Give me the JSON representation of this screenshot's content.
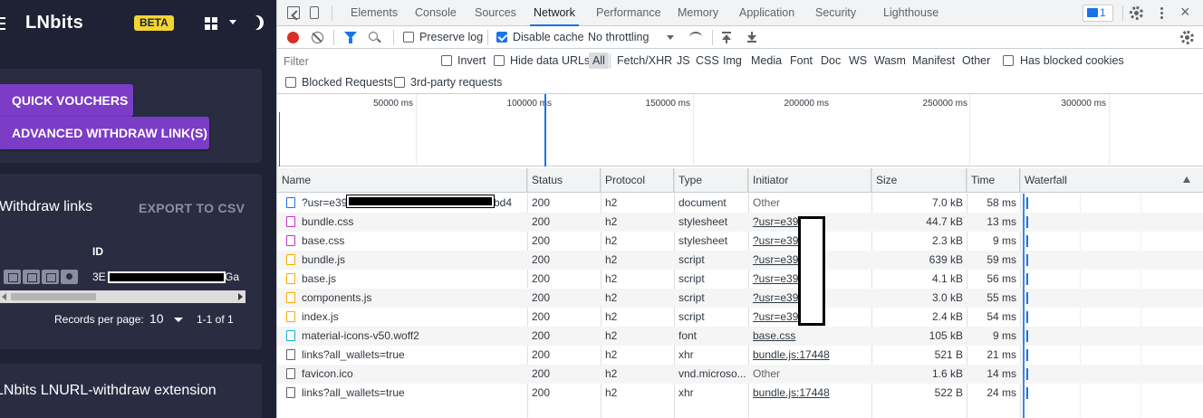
{
  "app": {
    "title": "LNbits",
    "beta_badge": "BETA",
    "buttons": {
      "quick_vouchers": "QUICK VOUCHERS",
      "advanced_withdraw": "ADVANCED WITHDRAW LINK(S)"
    },
    "withdraw_card": {
      "title": "Withdraw links",
      "export": "EXPORT TO CSV",
      "id_header": "ID",
      "row_id_prefix": "3E",
      "row_id_suffix": "Ga",
      "records_per_page_label": "Records per page:",
      "records_per_page_value": "10",
      "range": "1-1 of 1"
    },
    "extension_card": {
      "title": "LNbits LNURL-withdraw extension"
    },
    "icons": [
      "menu-icon",
      "grid-icon",
      "chevron-down-icon",
      "moon-icon",
      "link-icon",
      "square-icon",
      "list-icon",
      "eye-icon"
    ]
  },
  "devtools": {
    "tabs": [
      "Elements",
      "Console",
      "Sources",
      "Network",
      "Performance",
      "Memory",
      "Application",
      "Security",
      "Lighthouse"
    ],
    "active_tab": "Network",
    "messages_count": "1",
    "toolbar": {
      "preserve_log": "Preserve log",
      "disable_cache": "Disable cache",
      "throttling": "No throttling"
    },
    "filter": {
      "placeholder": "Filter",
      "invert": "Invert",
      "hide_data_urls": "Hide data URLs",
      "types": [
        "All",
        "Fetch/XHR",
        "JS",
        "CSS",
        "Img",
        "Media",
        "Font",
        "Doc",
        "WS",
        "Wasm",
        "Manifest",
        "Other"
      ],
      "has_blocked_cookies": "Has blocked cookies",
      "blocked_requests": "Blocked Requests",
      "third_party": "3rd-party requests"
    },
    "overview_ticks": [
      "50000 ms",
      "100000 ms",
      "150000 ms",
      "200000 ms",
      "250000 ms",
      "300000 ms"
    ],
    "columns": [
      "Name",
      "Status",
      "Protocol",
      "Type",
      "Initiator",
      "Size",
      "Time",
      "Waterfall"
    ],
    "rows": [
      {
        "name": "?usr=e39",
        "name_suffix": "bd4",
        "status": "200",
        "protocol": "h2",
        "type": "document",
        "initiator": "Other",
        "size": "7.0 kB",
        "time": "58 ms",
        "icon": "doc"
      },
      {
        "name": "bundle.css",
        "status": "200",
        "protocol": "h2",
        "type": "stylesheet",
        "initiator": "?usr=e39",
        "size": "44.7 kB",
        "time": "13 ms",
        "icon": "css"
      },
      {
        "name": "base.css",
        "status": "200",
        "protocol": "h2",
        "type": "stylesheet",
        "initiator": "?usr=e39",
        "size": "2.3 kB",
        "time": "9 ms",
        "icon": "css"
      },
      {
        "name": "bundle.js",
        "status": "200",
        "protocol": "h2",
        "type": "script",
        "initiator": "?usr=e39",
        "size": "639 kB",
        "time": "59 ms",
        "icon": "js"
      },
      {
        "name": "base.js",
        "status": "200",
        "protocol": "h2",
        "type": "script",
        "initiator": "?usr=e39",
        "size": "4.1 kB",
        "time": "56 ms",
        "icon": "js"
      },
      {
        "name": "components.js",
        "status": "200",
        "protocol": "h2",
        "type": "script",
        "initiator": "?usr=e39",
        "size": "3.0 kB",
        "time": "55 ms",
        "icon": "js"
      },
      {
        "name": "index.js",
        "status": "200",
        "protocol": "h2",
        "type": "script",
        "initiator": "?usr=e39",
        "size": "2.4 kB",
        "time": "54 ms",
        "icon": "js"
      },
      {
        "name": "material-icons-v50.woff2",
        "status": "200",
        "protocol": "h2",
        "type": "font",
        "initiator": "base.css",
        "size": "105 kB",
        "time": "9 ms",
        "icon": "font"
      },
      {
        "name": "links?all_wallets=true",
        "status": "200",
        "protocol": "h2",
        "type": "xhr",
        "initiator": "bundle.js:17448",
        "size": "521 B",
        "time": "21 ms",
        "icon": "other"
      },
      {
        "name": "favicon.ico",
        "status": "200",
        "protocol": "h2",
        "type": "vnd.microso...",
        "initiator": "Other",
        "size": "1.6 kB",
        "time": "14 ms",
        "icon": "other"
      },
      {
        "name": "links?all_wallets=true",
        "status": "200",
        "protocol": "h2",
        "type": "xhr",
        "initiator": "bundle.js:17448",
        "size": "522 B",
        "time": "24 ms",
        "icon": "other"
      }
    ],
    "colors": {
      "accent": "#1a73e8",
      "record": "#d93025",
      "app_bg": "#1f2234",
      "app_button": "#7b3cc6",
      "beta": "#f3d433"
    }
  }
}
